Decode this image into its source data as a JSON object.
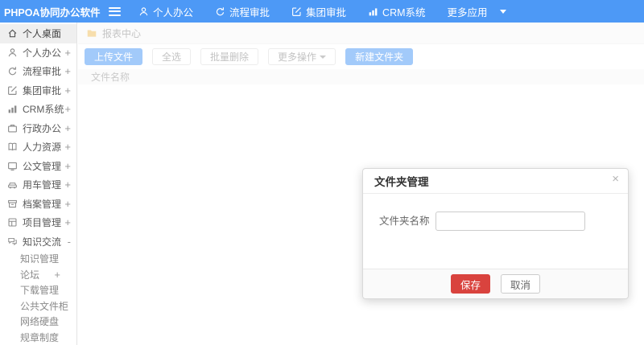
{
  "app": {
    "title": "PHPOA协同办公软件"
  },
  "topbar": {
    "items": [
      {
        "label": "个人办公",
        "icon": "user-icon"
      },
      {
        "label": "流程审批",
        "icon": "cycle-icon"
      },
      {
        "label": "集团审批",
        "icon": "edit-icon"
      },
      {
        "label": "CRM系统",
        "icon": "chart-icon"
      },
      {
        "label": "更多应用",
        "icon": "caret-down-icon"
      }
    ]
  },
  "sidebar": {
    "items": [
      {
        "label": "个人桌面",
        "icon": "home-icon",
        "expander": ""
      },
      {
        "label": "个人办公",
        "icon": "user-icon",
        "expander": "+"
      },
      {
        "label": "流程审批",
        "icon": "cycle-icon",
        "expander": "+"
      },
      {
        "label": "集团审批",
        "icon": "edit-icon",
        "expander": "+"
      },
      {
        "label": "CRM系统",
        "icon": "chart-icon",
        "expander": "+"
      },
      {
        "label": "行政办公",
        "icon": "briefcase-icon",
        "expander": "+"
      },
      {
        "label": "人力资源",
        "icon": "book-icon",
        "expander": "+"
      },
      {
        "label": "公文管理",
        "icon": "document-icon",
        "expander": "+"
      },
      {
        "label": "用车管理",
        "icon": "car-icon",
        "expander": "+"
      },
      {
        "label": "档案管理",
        "icon": "archive-icon",
        "expander": "+"
      },
      {
        "label": "项目管理",
        "icon": "project-icon",
        "expander": "+"
      },
      {
        "label": "知识交流",
        "icon": "chat-icon",
        "expander": "-"
      }
    ],
    "subitems": [
      {
        "label": "知识管理",
        "expander": ""
      },
      {
        "label": "论坛",
        "expander": "+"
      },
      {
        "label": "下载管理",
        "expander": ""
      },
      {
        "label": "公共文件柜",
        "expander": ""
      },
      {
        "label": "网络硬盘",
        "expander": ""
      },
      {
        "label": "规章制度",
        "expander": ""
      }
    ]
  },
  "breadcrumb": {
    "icon": "folder-icon",
    "label": "报表中心"
  },
  "toolbar": {
    "upload": "上传文件",
    "select_all": "全选",
    "batch_delete": "批量删除",
    "more_actions": "更多操作",
    "new_folder": "新建文件夹"
  },
  "table": {
    "headers": [
      "文件名称"
    ]
  },
  "modal": {
    "title": "文件夹管理",
    "close": "×",
    "field_label": "文件夹名称",
    "field_value": "",
    "save": "保存",
    "cancel": "取消"
  },
  "colors": {
    "accent": "#4d99f6",
    "danger": "#d9433e",
    "folder": "#f0c061"
  }
}
